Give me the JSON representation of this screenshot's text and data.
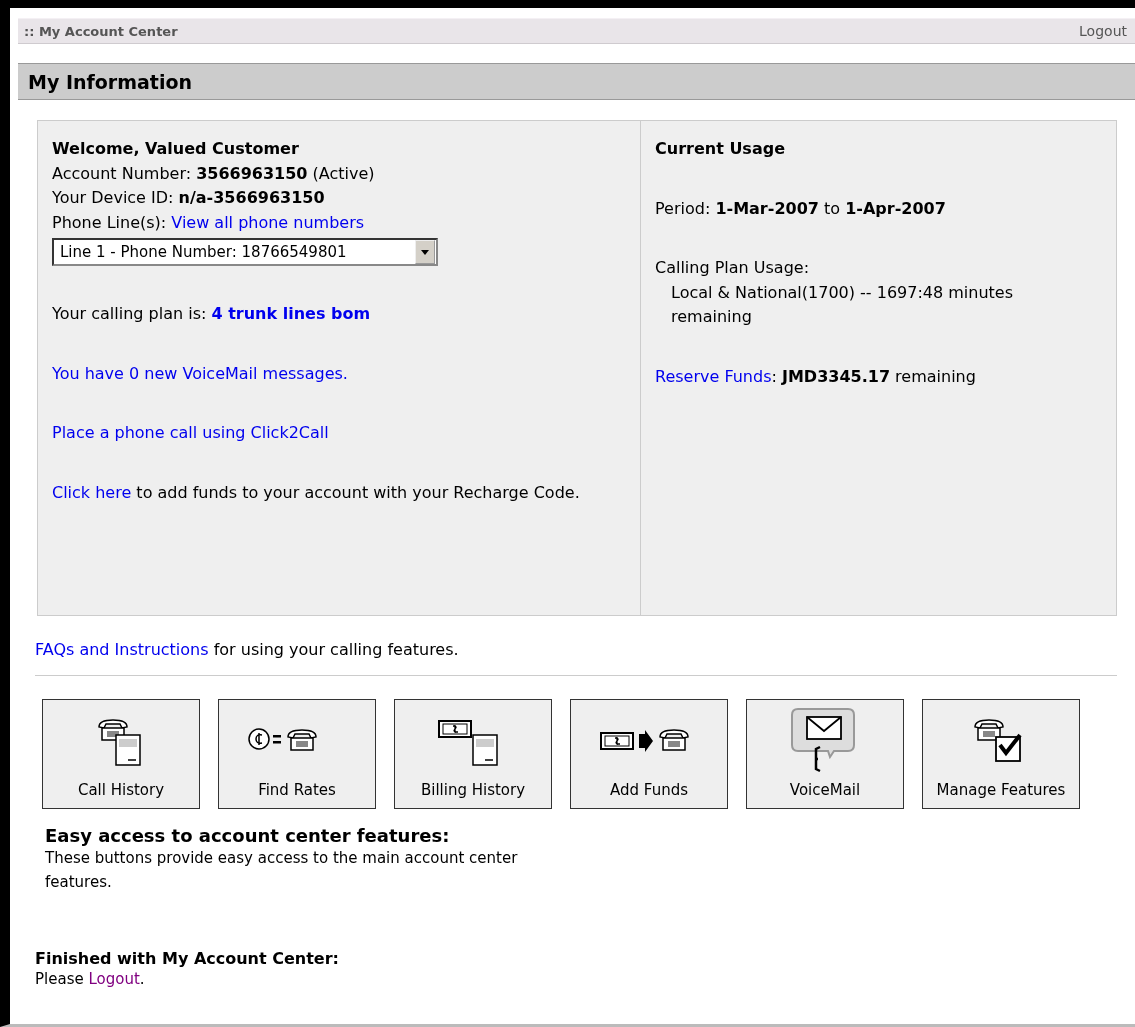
{
  "top_bar": {
    "title": ":: My Account Center",
    "logout": "Logout"
  },
  "section": {
    "title": "My Information"
  },
  "account": {
    "welcome": "Welcome, Valued Customer",
    "account_line": "Account Number: **3566963150** (Active)",
    "device_line": "Your Device ID: **n/a-3566963150**",
    "phone_label": "Phone Line(s):",
    "phone_link": "View all phone numbers",
    "line_select": {
      "value": "Line 1 - Phone Number: 18766549801"
    },
    "plan_label": "Your calling plan is:",
    "plan_link": "4 trunk lines bom",
    "voicemail_link": "You have 0 new VoiceMail messages.",
    "click2call_link": "Place a phone call using Click2Call",
    "recharge_link": "Click here",
    "recharge_text": "to add funds to your account with your Recharge Code."
  },
  "usage": {
    "title": "Current Usage",
    "period": "Period: **1-Mar-2007** to **1-Apr-2007**",
    "plan_usage_label": "Calling Plan Usage:",
    "plan_usage": "Local & National(1700) -- 1697:48 minutes remaining",
    "funds_link": "Reserve Funds",
    "funds_text": ": **JMD3345.17** remaining"
  },
  "faq": {
    "link": "FAQs and Instructions",
    "text": "for using your calling features."
  },
  "feature_buttons": [
    {
      "kind": "call-history",
      "label": "Call History"
    },
    {
      "kind": "find-rates",
      "label": "Find Rates"
    },
    {
      "kind": "billing-history",
      "label": "Billing History"
    },
    {
      "kind": "add-funds",
      "label": "Add Funds"
    },
    {
      "kind": "voicemail",
      "label": "VoiceMail"
    },
    {
      "kind": "manage-features",
      "label": "Manage Features"
    }
  ],
  "features_help": {
    "title": "Easy access to account center features:",
    "text": "These buttons provide easy access to the main account center features."
  },
  "finish": {
    "title": "Finished with My Account Center:",
    "before": "Please",
    "link": "Logout",
    "after": "."
  }
}
